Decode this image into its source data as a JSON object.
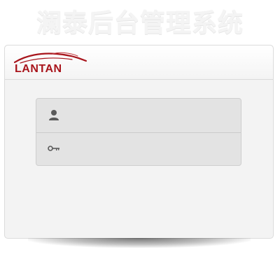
{
  "header": {
    "system_title": "澜泰后台管理系统"
  },
  "logo": {
    "brand_text": "LANTAN",
    "brand_color": "#a8141b"
  },
  "login_form": {
    "username": {
      "icon": "user-icon",
      "value": "",
      "placeholder": ""
    },
    "password": {
      "icon": "key-icon",
      "value": "",
      "placeholder": ""
    }
  }
}
